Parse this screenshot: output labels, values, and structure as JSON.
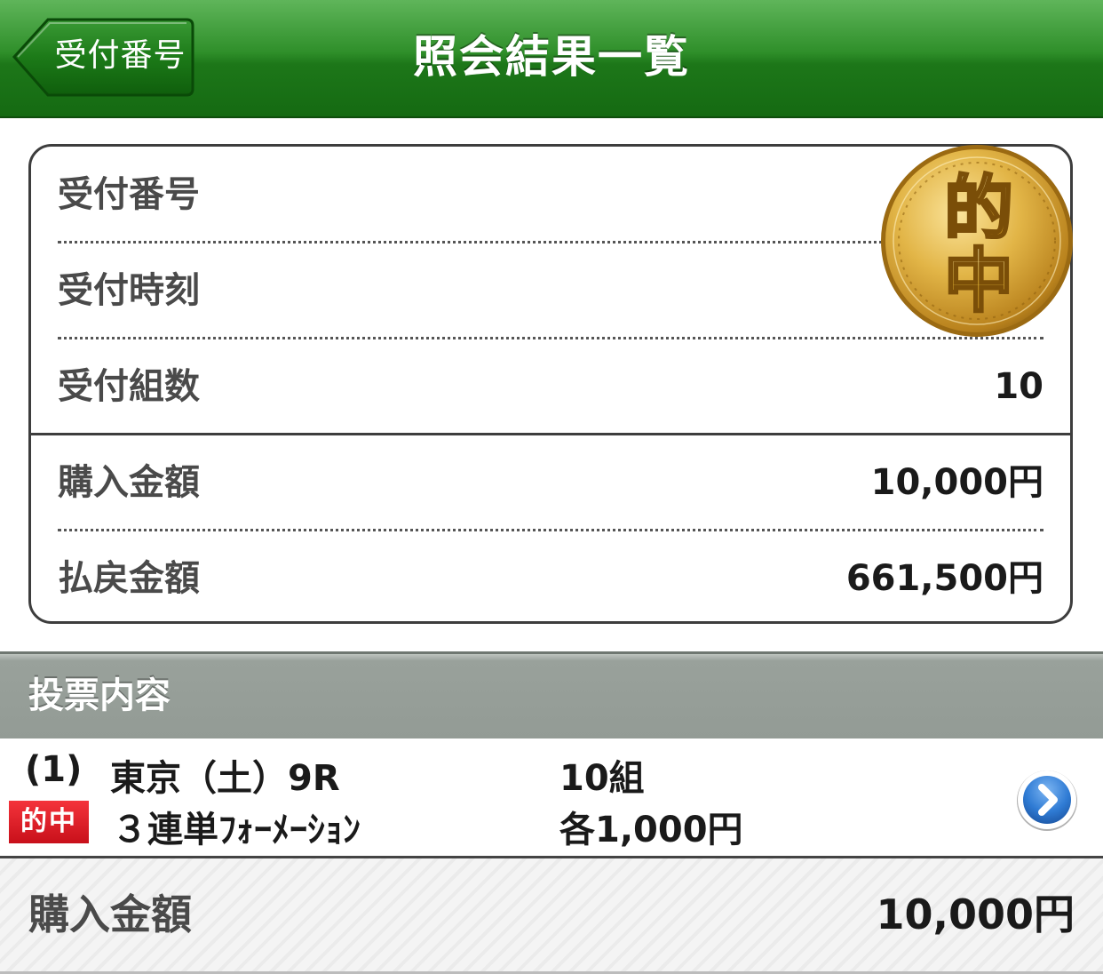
{
  "header": {
    "back_label": "受付番号",
    "title": "照会結果一覧"
  },
  "summary": {
    "medal_top": "的",
    "medal_bottom": "中",
    "rows": [
      {
        "label": "受付番号",
        "value": ""
      },
      {
        "label": "受付時刻",
        "value": ""
      },
      {
        "label": "受付組数",
        "value": "10"
      },
      {
        "label": "購入金額",
        "value": "10,000円"
      },
      {
        "label": "払戻金額",
        "value": "661,500円"
      }
    ]
  },
  "section": {
    "title": "投票内容"
  },
  "bet": {
    "index": "(1)",
    "race": "東京（土）9R",
    "badge": "的中",
    "bet_type": "３連単ﾌｫｰﾒｰｼｮﾝ",
    "combos": "10組",
    "each_amount": "各1,000円"
  },
  "total": {
    "label": "購入金額",
    "value": "10,000円"
  },
  "colors": {
    "header_green": "#1d7719",
    "badge_red": "#e0202a",
    "medal_gold": "#d8a32a",
    "section_gray": "#939b95",
    "chevron_blue": "#2f7bd4"
  }
}
